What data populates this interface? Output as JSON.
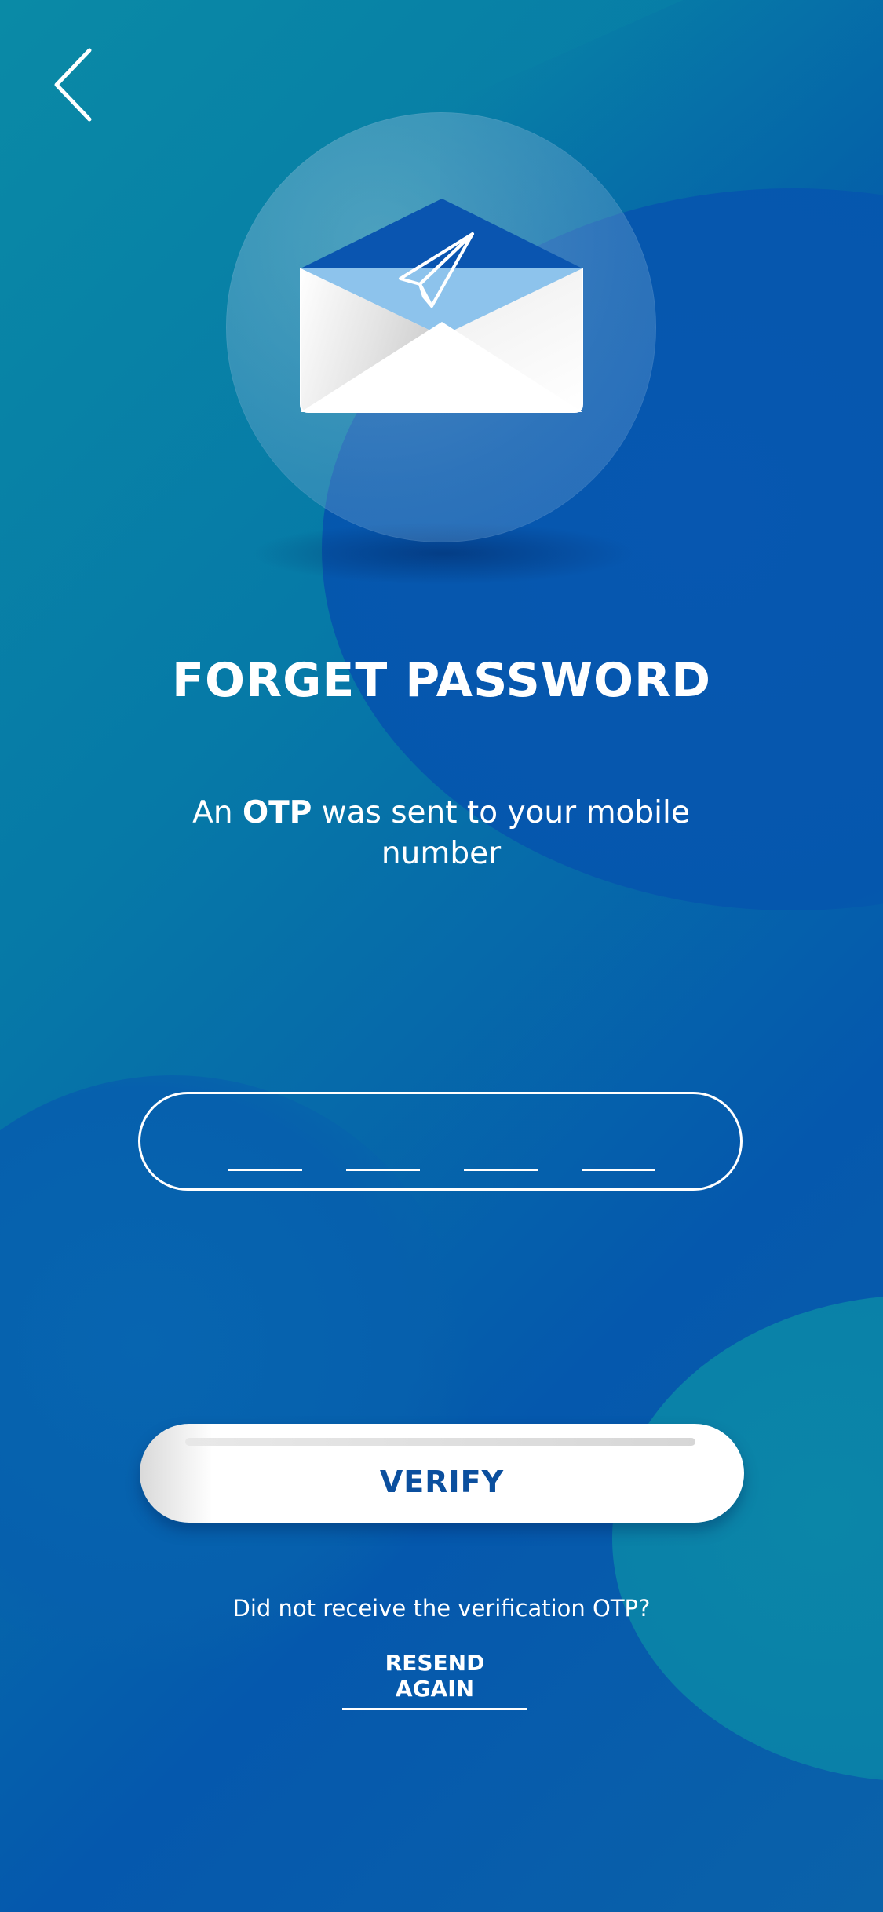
{
  "header": {
    "back_icon": "chevron-left-icon"
  },
  "hero": {
    "icon": "envelope-paper-plane-icon"
  },
  "title": "FORGET PASSWORD",
  "subtitle": {
    "prefix": "An ",
    "emphasis": "OTP",
    "suffix": " was sent to your mobile number"
  },
  "otp": {
    "length": 4,
    "value": ""
  },
  "verify": {
    "label": "VERIFY"
  },
  "resend": {
    "prompt": "Did not receive the verification OTP?",
    "link_label": "RESEND AGAIN"
  },
  "colors": {
    "accent_text": "#0b4f9e",
    "foreground": "#ffffff",
    "background_start": "#0a8aa6",
    "background_end": "#0558ad"
  }
}
